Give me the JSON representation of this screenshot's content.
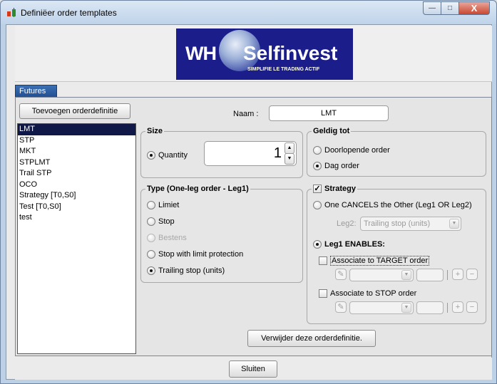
{
  "window": {
    "title": "Definiëer order templates",
    "minimize": "—",
    "maximize": "□",
    "close": "X"
  },
  "logo": {
    "wh": "WH",
    "brand": "Selfinvest",
    "tagline": "SIMPLIFIE LE TRADING ACTIF"
  },
  "tabs": [
    {
      "label": "Futures"
    }
  ],
  "add_button": "Toevoegen orderdefinitie",
  "templates": [
    "LMT",
    "STP",
    "MKT",
    "STPLMT",
    "Trail STP",
    "OCO",
    "Strategy [T0,S0]",
    "Test [T0,S0]",
    "test"
  ],
  "name": {
    "label": "Naam :",
    "value": "LMT"
  },
  "size": {
    "title": "Size",
    "quantity_label": "Quantity",
    "quantity_value": "1",
    "spin_up": "▲",
    "spin_down": "▼"
  },
  "valid_until": {
    "title": "Geldig tot",
    "options": [
      {
        "label": "Doorlopende order",
        "selected": false
      },
      {
        "label": "Dag order",
        "selected": true
      }
    ]
  },
  "type": {
    "title": "Type (One-leg order - Leg1)",
    "options": [
      {
        "label": "Limiet",
        "selected": false,
        "disabled": false
      },
      {
        "label": "Stop",
        "selected": false,
        "disabled": false
      },
      {
        "label": "Bestens",
        "selected": false,
        "disabled": true
      },
      {
        "label": "Stop with limit protection",
        "selected": false,
        "disabled": false
      },
      {
        "label": "Trailing stop (units)",
        "selected": true,
        "disabled": false
      }
    ]
  },
  "strategy": {
    "title": "Strategy",
    "checked": true,
    "check_mark": "✓",
    "oco_label": "One CANCELS the Other (Leg1 OR Leg2)",
    "leg2_label": "Leg2:",
    "leg2_value": "Trailing stop (units)",
    "leg1_label": "Leg1 ENABLES:",
    "target_label": "Associate to TARGET order",
    "stop_label": "Associate to STOP order",
    "plus": "+",
    "minus": "−",
    "edit_glyph": "✎",
    "arrow_glyph": "▼"
  },
  "delete_button": "Verwijder deze orderdefinitie.",
  "close_button": "Sluiten"
}
